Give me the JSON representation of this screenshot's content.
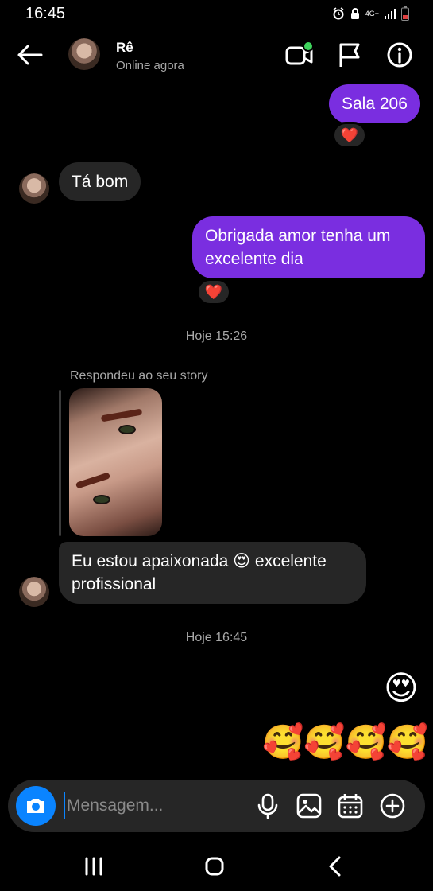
{
  "status_bar": {
    "time": "16:45",
    "network": "4G+"
  },
  "header": {
    "contact_name": "Rê",
    "contact_status": "Online agora",
    "online_dot_color": "#3ed35c"
  },
  "messages": [
    {
      "direction": "out",
      "text": "Sala 206",
      "reaction": "❤️"
    },
    {
      "direction": "in",
      "text": "Tá bom"
    },
    {
      "direction": "out",
      "text": "Obrigada amor tenha um excelente dia",
      "reaction": "❤️"
    }
  ],
  "timestamps": [
    "Hoje 15:26",
    "Hoje 16:45"
  ],
  "story_reply": {
    "caption": "Respondeu ao seu story",
    "text": "Eu estou apaixonada 😍 excelente profissional"
  },
  "emoji_messages": [
    "😍",
    "🥰🥰🥰🥰"
  ],
  "composer": {
    "placeholder": "Mensagem..."
  },
  "colors": {
    "outgoing_bubble": "#7a2ee0",
    "incoming_bubble": "#262626",
    "accent": "#0a84ff",
    "background": "#000000"
  }
}
